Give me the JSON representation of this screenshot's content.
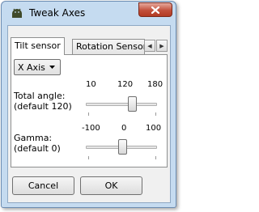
{
  "window": {
    "title": "Tweak Axes"
  },
  "tabs": [
    {
      "label": "Tilt sensor",
      "active": true
    },
    {
      "label": "Rotation Sensor",
      "active": false
    }
  ],
  "axis_select": {
    "value": "X Axis"
  },
  "total_angle": {
    "label_line1": "Total angle:",
    "label_line2": "(default 120)",
    "tick_min": "10",
    "tick_mid": "120",
    "tick_max": "180",
    "value": 120
  },
  "gamma": {
    "label_line1": "Gamma:",
    "label_line2": "(default 0)",
    "tick_min": "-100",
    "tick_mid": "0",
    "tick_max": "100",
    "value": 0
  },
  "buttons": {
    "cancel": "Cancel",
    "ok": "OK"
  }
}
